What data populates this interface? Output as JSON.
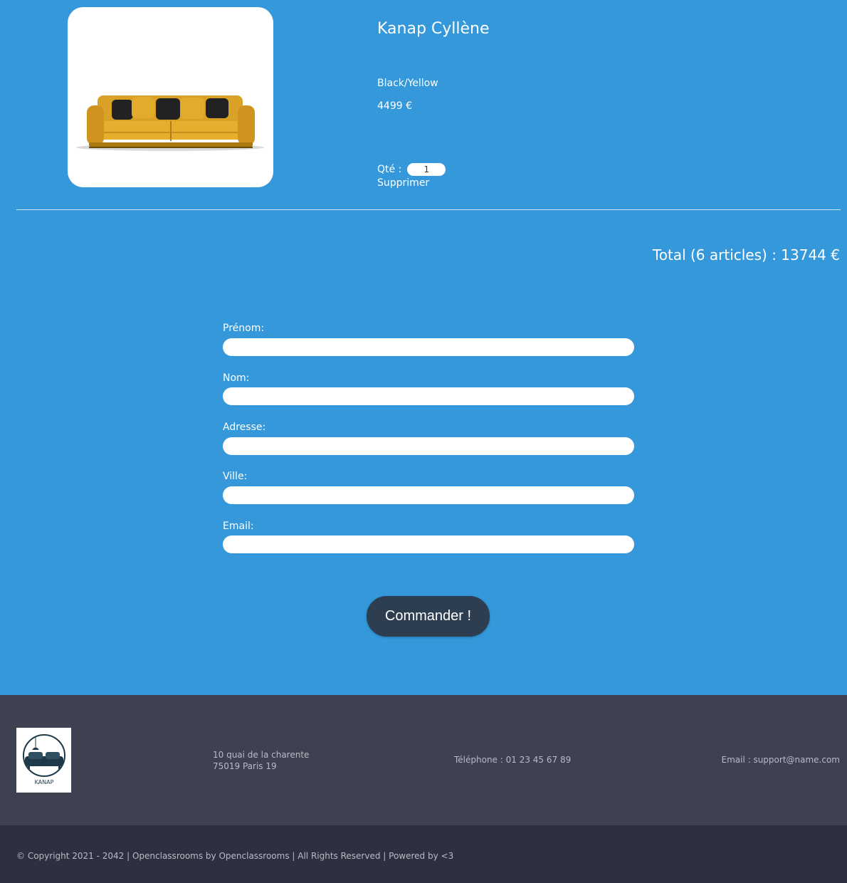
{
  "cart": {
    "item": {
      "name": "Kanap Cyllène",
      "color": "Black/Yellow",
      "price": "4499 €",
      "quantity_label": "Qté :",
      "quantity_value": "1",
      "delete_label": "Supprimer"
    },
    "total": "Total (6 articles) : 13744 €"
  },
  "form": {
    "first_name_label": "Prénom:",
    "last_name_label": "Nom:",
    "address_label": "Adresse:",
    "city_label": "Ville:",
    "email_label": "Email:",
    "submit_label": "Commander !"
  },
  "footer": {
    "logo_text": "KANAP",
    "address_line1": "10 quai de la charente",
    "address_line2": "75019 Paris 19",
    "phone": "Téléphone : 01 23 45 67 89",
    "email": "Email : support@name.com",
    "copyright": "© Copyright 2021 - 2042 | Openclassrooms by Openclassrooms | All Rights Reserved | Powered by <3"
  },
  "colors": {
    "background": "#3498db",
    "button": "#2c3e50",
    "footer_top": "#3d4150",
    "footer_bottom": "#2d303e"
  }
}
